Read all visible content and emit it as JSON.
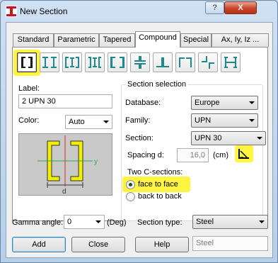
{
  "window": {
    "title": "New Section",
    "help_glyph": "?",
    "close_glyph": "X"
  },
  "tabs": [
    "Standard",
    "Parametric",
    "Tapered",
    "Compound",
    "Special",
    "Ax, Iy, Iz ..."
  ],
  "active_tab": "Compound",
  "shape_buttons": [
    "two-c-face-to-face-icon",
    "two-i-beams-icon",
    "i-with-c-sides-icon",
    "i-with-c-back-icon",
    "two-c-back-to-back-icon",
    "cross-angles-icon",
    "t-section-icon",
    "channel-back-icon",
    "offset-angles-icon",
    "h-section-icon"
  ],
  "selected_shape": "two-c-face-to-face-icon",
  "label_field": {
    "caption": "Label:",
    "value": "2 UPN 30"
  },
  "color_field": {
    "caption": "Color:",
    "value": "Auto"
  },
  "preview": {
    "axis_y": "y",
    "axis_d": "d"
  },
  "section_selection": {
    "title": "Section selection",
    "database": {
      "caption": "Database:",
      "value": "Europe"
    },
    "family": {
      "caption": "Family:",
      "value": "UPN"
    },
    "section": {
      "caption": "Section:",
      "value": "UPN 30"
    },
    "spacing": {
      "caption": "Spacing  d:",
      "value": "16,0",
      "unit": "(cm)"
    },
    "two_c_sections": {
      "caption": "Two C-sections:",
      "options": [
        "face to face",
        "back to back"
      ],
      "selected": "face to face"
    }
  },
  "gamma_angle": {
    "caption": "Gamma angle:",
    "value": "0",
    "unit": "(Deg)"
  },
  "section_type": {
    "caption": "Section type:",
    "value": "Steel"
  },
  "buttons": {
    "add": "Add",
    "close": "Close",
    "help": "Help"
  },
  "material_field": {
    "value": "Steel"
  },
  "colors": {
    "highlight": "#fff200",
    "section_fill": "#f2ee00",
    "accent": "#3c7fb1"
  }
}
